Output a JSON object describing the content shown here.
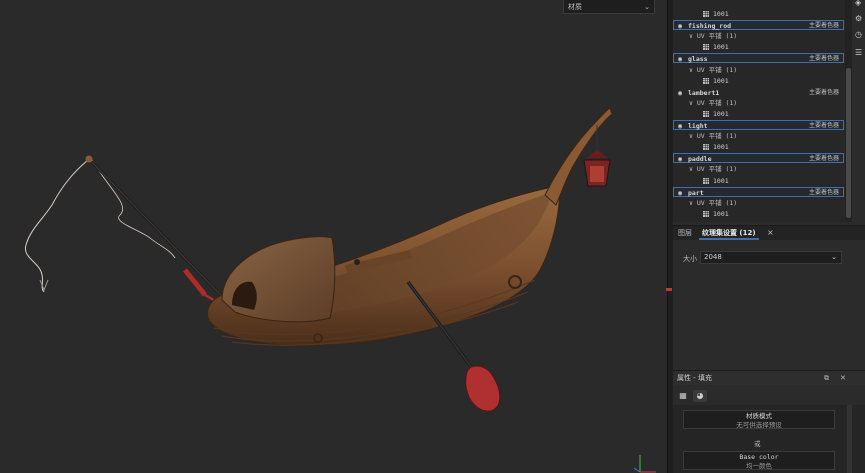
{
  "viewport": {
    "dropdown_label": "材质",
    "dropdown_chevron": "⌄"
  },
  "texture_sets": {
    "rows": [
      {
        "kind": "tile",
        "tile": "1001"
      },
      {
        "kind": "mat",
        "name": "fishing_rod",
        "shader": "主要着色器",
        "selected": true
      },
      {
        "kind": "uv",
        "label": "∨ UV 平铺 (1)"
      },
      {
        "kind": "tile",
        "tile": "1001"
      },
      {
        "kind": "mat",
        "name": "glass",
        "shader": "主要着色器",
        "selected": true
      },
      {
        "kind": "uv",
        "label": "∨ UV 平铺 (1)"
      },
      {
        "kind": "tile",
        "tile": "1001"
      },
      {
        "kind": "mat",
        "name": "lambert1",
        "shader": "主要着色器",
        "selected": false
      },
      {
        "kind": "uv",
        "label": "∨ UV 平铺 (1)"
      },
      {
        "kind": "tile",
        "tile": "1001"
      },
      {
        "kind": "mat",
        "name": "light",
        "shader": "主要着色器",
        "selected": true
      },
      {
        "kind": "uv",
        "label": "∨ UV 平铺 (1)"
      },
      {
        "kind": "tile",
        "tile": "1001"
      },
      {
        "kind": "mat",
        "name": "paddle",
        "shader": "主要着色器",
        "selected": true
      },
      {
        "kind": "uv",
        "label": "∨ UV 平铺 (1)"
      },
      {
        "kind": "tile",
        "tile": "1001"
      },
      {
        "kind": "mat",
        "name": "part",
        "shader": "主要着色器",
        "selected": true
      },
      {
        "kind": "uv",
        "label": "∨ UV 平铺 (1)"
      },
      {
        "kind": "tile",
        "tile": "1001"
      }
    ],
    "top_field": "设置"
  },
  "tabs": {
    "layers": "图层",
    "texset_settings": "纹理集设置 (12)",
    "close": "×"
  },
  "size": {
    "label": "大小",
    "value": "2048",
    "chevron": "⌄"
  },
  "properties": {
    "title": "属性 - 填充",
    "material_mode_label": "材质模式",
    "material_mode_hint": "无可供选择预设",
    "or_text": "或",
    "base_color_label": "Base color",
    "base_color_hint": "均一颜色"
  },
  "colors": {
    "accent": "#3b6fb0",
    "background": "#262626"
  }
}
